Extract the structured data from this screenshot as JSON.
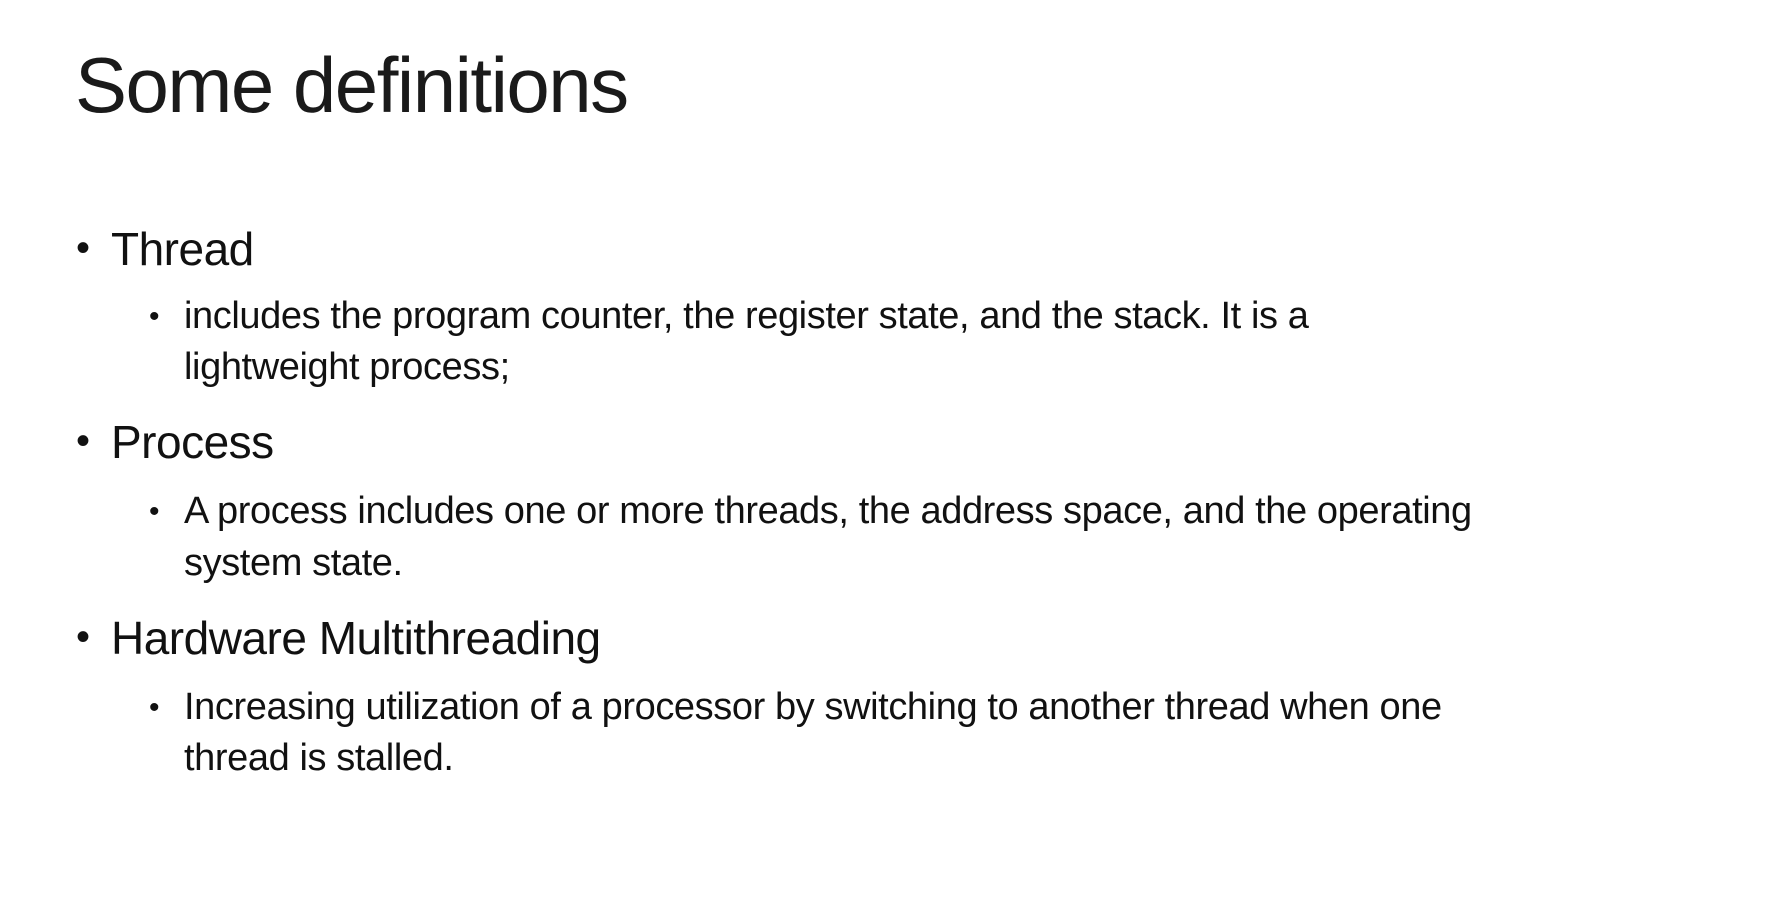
{
  "slide": {
    "title": "Some definitions",
    "bullet_glyph": "•",
    "items": [
      {
        "term": "Thread",
        "definition_lines": [
          "includes the program counter, the register state, and the stack. It is a",
          "lightweight process;"
        ]
      },
      {
        "term": "Process",
        "definition_lines": [
          "A process includes one or more threads, the address space, and the operating",
          "system state."
        ]
      },
      {
        "term": "Hardware Multithreading",
        "definition_lines": [
          "Increasing utilization of a processor by switching to another thread when one",
          "thread is stalled."
        ]
      }
    ]
  }
}
